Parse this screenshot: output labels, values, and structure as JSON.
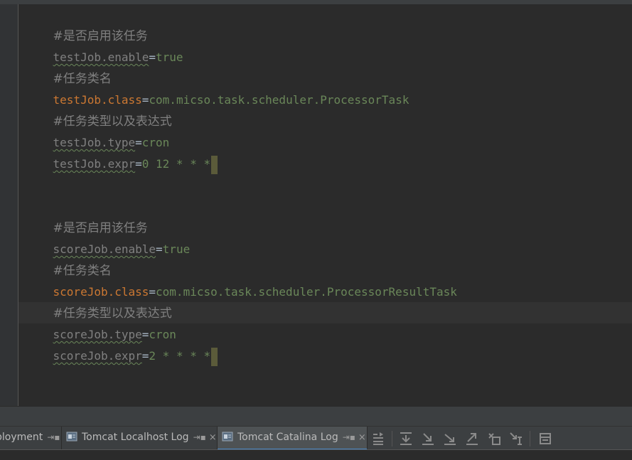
{
  "editor": {
    "lines": [
      {
        "comment": "#是否启用该任务"
      },
      {
        "key": "testJob.enable",
        "value": "true"
      },
      {
        "comment": "#任务类名"
      },
      {
        "key": "testJob.class",
        "value": "com.micso.task.scheduler.ProcessorTask"
      },
      {
        "comment": "#任务类型以及表达式"
      },
      {
        "key": "testJob.type",
        "value": "cron"
      },
      {
        "key": "testJob.expr",
        "value": "0 12 * * *"
      },
      {
        "comment": "#是否启用该任务"
      },
      {
        "key": "scoreJob.enable",
        "value": "true"
      },
      {
        "comment": "#任务类名"
      },
      {
        "key": "scoreJob.class",
        "value": "com.micso.task.scheduler.ProcessorResultTask"
      },
      {
        "comment": "#任务类型以及表达式"
      },
      {
        "key": "scoreJob.type",
        "value": "cron"
      },
      {
        "key": "scoreJob.expr",
        "value": "2 * * * *"
      }
    ],
    "colors": {
      "background": "#2b2b2b",
      "comment": "#808080",
      "key": "#808080",
      "key_highlight": "#cc7832",
      "value": "#6a8759",
      "equals": "#a9b7c6"
    }
  },
  "tabs": [
    {
      "label": "ployment",
      "pin": "⇥▪"
    },
    {
      "label": "Tomcat Localhost Log",
      "pin": "⇥▪",
      "close": "×"
    },
    {
      "label": "Tomcat Catalina Log",
      "pin": "⇥▪",
      "close": "×",
      "active": true
    }
  ],
  "toolbar": {
    "icons": [
      "soft-wrap-icon",
      "scroll-to-end-icon",
      "down-arrow-icon",
      "down-right-arrow-icon",
      "up-right-arrow-icon",
      "clear-all-icon",
      "filter-icon",
      "print-icon"
    ]
  }
}
